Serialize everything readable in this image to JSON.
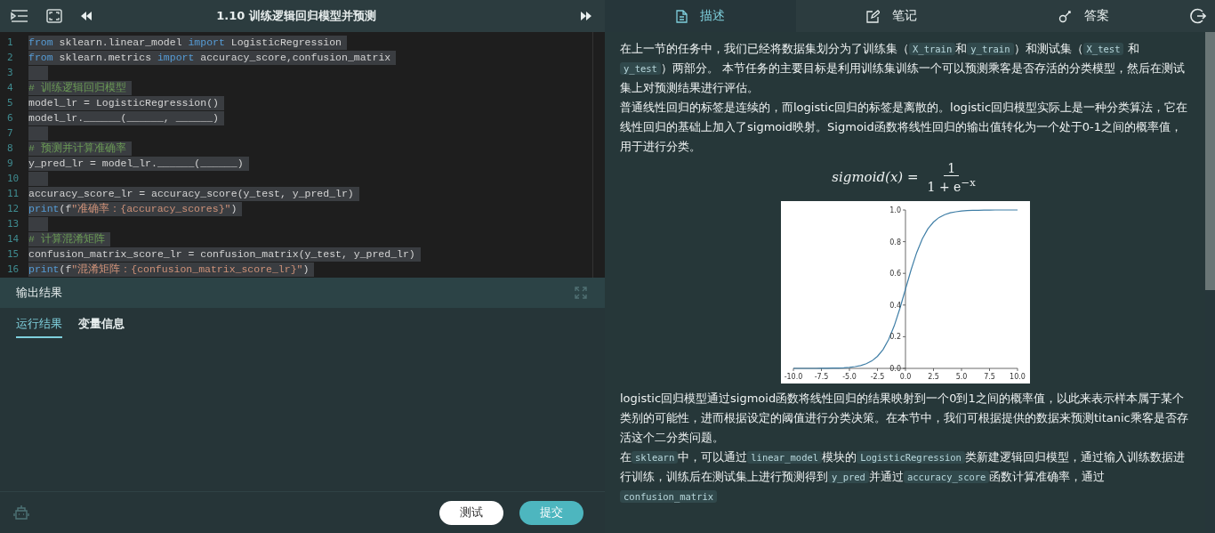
{
  "editor": {
    "title": "1.10 训练逻辑回归模型并预测",
    "lines": [
      {
        "number": "1",
        "tokens": [
          {
            "kind": "keyword",
            "text": "from"
          },
          {
            "kind": "plain",
            "text": " sklearn.linear_model "
          },
          {
            "kind": "keyword",
            "text": "import"
          },
          {
            "kind": "plain",
            "text": " LogisticRegression"
          }
        ]
      },
      {
        "number": "2",
        "tokens": [
          {
            "kind": "keyword",
            "text": "from"
          },
          {
            "kind": "plain",
            "text": " sklearn.metrics "
          },
          {
            "kind": "keyword",
            "text": "import"
          },
          {
            "kind": "plain",
            "text": " accuracy_score,confusion_matrix"
          }
        ]
      },
      {
        "number": "3"
      },
      {
        "number": "4",
        "tokens": [
          {
            "kind": "comment",
            "text": "# 训练逻辑回归模型"
          }
        ]
      },
      {
        "number": "5",
        "tokens": [
          {
            "kind": "plain",
            "text": "model_lr = LogisticRegression()"
          }
        ]
      },
      {
        "number": "6",
        "tokens": [
          {
            "kind": "plain",
            "text": "model_lr.______(______, ______)"
          }
        ]
      },
      {
        "number": "7"
      },
      {
        "number": "8",
        "tokens": [
          {
            "kind": "comment",
            "text": "# 预测并计算准确率"
          }
        ]
      },
      {
        "number": "9",
        "tokens": [
          {
            "kind": "plain",
            "text": "y_pred_lr = model_lr.______(______)"
          }
        ]
      },
      {
        "number": "10"
      },
      {
        "number": "11",
        "tokens": [
          {
            "kind": "plain",
            "text": "accuracy_score_lr = accuracy_score(y_test, y_pred_lr)"
          }
        ]
      },
      {
        "number": "12",
        "tokens": [
          {
            "kind": "keyword",
            "text": "print"
          },
          {
            "kind": "plain",
            "text": "(f"
          },
          {
            "kind": "string",
            "text": "\"准确率：{accuracy_scores}\""
          },
          {
            "kind": "plain",
            "text": ")"
          }
        ]
      },
      {
        "number": "13"
      },
      {
        "number": "14",
        "tokens": [
          {
            "kind": "comment",
            "text": "# 计算混淆矩阵"
          }
        ]
      },
      {
        "number": "15",
        "tokens": [
          {
            "kind": "plain",
            "text": "confusion_matrix_score_lr = confusion_matrix(y_test, y_pred_lr)"
          }
        ]
      },
      {
        "number": "16",
        "tokens": [
          {
            "kind": "keyword",
            "text": "print"
          },
          {
            "kind": "plain",
            "text": "(f"
          },
          {
            "kind": "string",
            "text": "\"混淆矩阵：{confusion_matrix_score_lr}\""
          },
          {
            "kind": "plain",
            "text": ")"
          }
        ]
      }
    ]
  },
  "output": {
    "title": "输出结果",
    "tabs": [
      {
        "label": "运行结果",
        "selected": true
      },
      {
        "label": "变量信息",
        "selected": false
      }
    ]
  },
  "actions": [
    {
      "label": "测试",
      "kind": "secondary"
    },
    {
      "label": "提交",
      "kind": "primary"
    }
  ],
  "right_tabs": [
    {
      "label": "描述",
      "selected": true
    },
    {
      "label": "笔记",
      "selected": false
    },
    {
      "label": "答案",
      "selected": false
    }
  ],
  "content": [
    {
      "kind": "paragraph",
      "segments": [
        {
          "kind": "text",
          "text": "在上一节的任务中，我们已经将数据集划分为了训练集（"
        },
        {
          "kind": "code",
          "text": "X_train"
        },
        {
          "kind": "text",
          "text": "和"
        },
        {
          "kind": "code",
          "text": "y_train"
        },
        {
          "kind": "text",
          "text": "）和测试集（"
        },
        {
          "kind": "code",
          "text": "X_test"
        },
        {
          "kind": "text",
          "text": " 和"
        },
        {
          "kind": "code",
          "text": "y_test"
        },
        {
          "kind": "text",
          "text": "）两部分。 本节任务的主要目标是利用训练集训练一个可以预测乘客是否存活的分类模型，然后在测试集上对预测结果进行评估。"
        }
      ]
    },
    {
      "kind": "paragraph",
      "segments": [
        {
          "kind": "text",
          "text": "普通线性回归的标签是连续的，而logistic回归的标签是离散的。logistic回归模型实际上是一种分类算法，它在线性回归的基础上加入了sigmoid映射。Sigmoid函数将线性回归的输出值转化为一个处于0-1之间的概率值，用于进行分类。"
        }
      ]
    },
    {
      "kind": "formula",
      "lhs": "sigmoid(x) =",
      "numerator": "1",
      "denominator": "1 + e$^{−x}$"
    },
    {
      "kind": "figure",
      "chart_data": {
        "type": "line",
        "x": [
          -10,
          -9.5,
          -9,
          -8.5,
          -8,
          -7.5,
          -7,
          -6.5,
          -6,
          -5.5,
          -5,
          -4.5,
          -4,
          -3.5,
          -3,
          -2.5,
          -2,
          -1.5,
          -1,
          -0.5,
          0,
          0.5,
          1,
          1.5,
          2,
          2.5,
          3,
          3.5,
          4,
          4.5,
          5,
          5.5,
          6,
          6.5,
          7,
          7.5,
          8,
          8.5,
          9,
          9.5,
          10
        ],
        "series": [
          {
            "color": "#3f7ea6",
            "values": [
              0.0,
              0.0,
              0.0,
              0.0,
              0.0,
              0.001,
              0.001,
              0.002,
              0.002,
              0.004,
              0.007,
              0.011,
              0.018,
              0.029,
              0.047,
              0.076,
              0.119,
              0.182,
              0.269,
              0.378,
              0.5,
              0.622,
              0.731,
              0.818,
              0.881,
              0.924,
              0.953,
              0.971,
              0.982,
              0.989,
              0.993,
              0.996,
              0.998,
              0.998,
              0.999,
              0.999,
              1.0,
              1.0,
              1.0,
              1.0,
              1.0
            ]
          }
        ],
        "xlim": [
          -10,
          10
        ],
        "ylim": [
          0,
          1
        ],
        "xticks": [
          {
            "value": -10,
            "label": "-10.0"
          },
          {
            "value": -7.5,
            "label": "-7.5"
          },
          {
            "value": -5,
            "label": "-5.0"
          },
          {
            "value": -2.5,
            "label": "-2.5"
          },
          {
            "value": 0,
            "label": "0.0"
          },
          {
            "value": 2.5,
            "label": "2.5"
          },
          {
            "value": 5,
            "label": "5.0"
          },
          {
            "value": 7.5,
            "label": "7.5"
          },
          {
            "value": 10,
            "label": "10.0"
          }
        ],
        "yticks": [
          {
            "value": 0,
            "label": "0.0"
          },
          {
            "value": 0.2,
            "label": "0.2"
          },
          {
            "value": 0.4,
            "label": "0.4"
          },
          {
            "value": 0.6,
            "label": "0.6"
          },
          {
            "value": 0.8,
            "label": "0.8"
          },
          {
            "value": 1,
            "label": "1.0"
          }
        ]
      }
    },
    {
      "kind": "paragraph",
      "segments": [
        {
          "kind": "text",
          "text": "logistic回归模型通过sigmoid函数将线性回归的结果映射到一个0到1之间的概率值，以此来表示样本属于某个类别的可能性，进而根据设定的阈值进行分类决策。在本节中，我们可根据提供的数据来预测titanic乘客是否存活这个二分类问题。"
        }
      ]
    },
    {
      "kind": "paragraph",
      "segments": [
        {
          "kind": "text",
          "text": "在"
        },
        {
          "kind": "code",
          "text": "sklearn"
        },
        {
          "kind": "text",
          "text": "中，可以通过"
        },
        {
          "kind": "code",
          "text": "linear_model"
        },
        {
          "kind": "text",
          "text": "模块的"
        },
        {
          "kind": "code",
          "text": "LogisticRegression"
        },
        {
          "kind": "text",
          "text": "类新建逻辑回归模型，通过输入训练数据进行训练，训练后在测试集上进行预测得到"
        },
        {
          "kind": "code",
          "text": "y_pred"
        },
        {
          "kind": "text",
          "text": "并通过"
        },
        {
          "kind": "code",
          "text": "accuracy_score"
        },
        {
          "kind": "text",
          "text": "函数计算准确率，通过"
        },
        {
          "kind": "code",
          "text": "confusion_matrix"
        }
      ]
    }
  ]
}
